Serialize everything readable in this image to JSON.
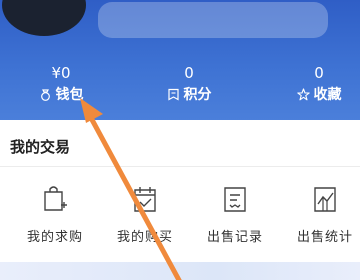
{
  "profile": {
    "stats": [
      {
        "value": "¥0",
        "label": "钱包",
        "icon": "wallet-icon"
      },
      {
        "value": "0",
        "label": "积分",
        "icon": "points-icon"
      },
      {
        "value": "0",
        "label": "收藏",
        "icon": "star-icon"
      }
    ]
  },
  "trades": {
    "title": "我的交易",
    "actions": [
      {
        "label": "我的求购",
        "icon": "shopping-bag-add-icon"
      },
      {
        "label": "我的购买",
        "icon": "calendar-check-icon"
      },
      {
        "label": "出售记录",
        "icon": "record-list-icon"
      },
      {
        "label": "出售统计",
        "icon": "chart-icon"
      }
    ]
  },
  "colors": {
    "header": "#3e72d3",
    "arrow": "#f08a3c"
  }
}
